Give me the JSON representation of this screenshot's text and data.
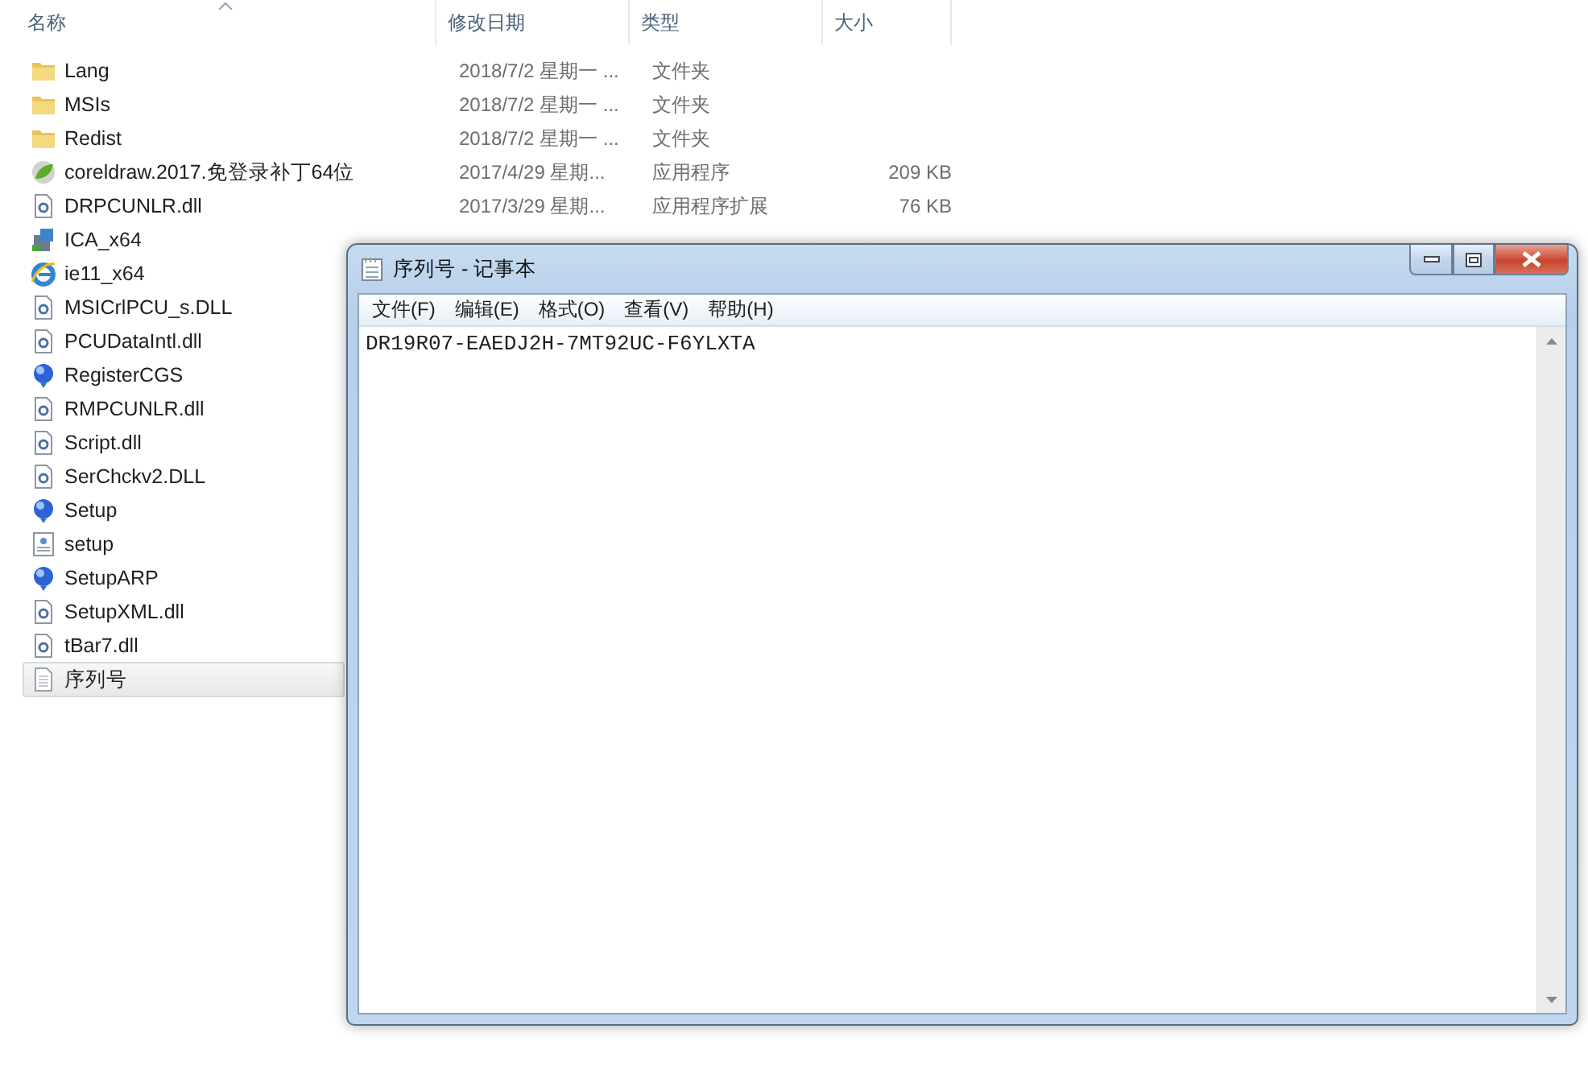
{
  "columns": [
    {
      "label": "名称",
      "sorted": true
    },
    {
      "label": "修改日期",
      "sorted": false
    },
    {
      "label": "类型",
      "sorted": false
    },
    {
      "label": "大小",
      "sorted": false
    }
  ],
  "files": [
    {
      "name": "Lang",
      "date": "2018/7/2 星期一 ...",
      "type": "文件夹",
      "kind": "folder",
      "selected": false
    },
    {
      "name": "MSIs",
      "date": "2018/7/2 星期一 ...",
      "type": "文件夹",
      "kind": "folder",
      "selected": false
    },
    {
      "name": "Redist",
      "date": "2018/7/2 星期一 ...",
      "type": "文件夹",
      "kind": "folder",
      "selected": false
    },
    {
      "name": "coreldraw.2017.免登录补丁64位",
      "date": "2017/4/29 星期...",
      "type": "应用程序",
      "size": "209 KB",
      "kind": "app",
      "selected": false
    },
    {
      "name": "DRPCUNLR.dll",
      "date": "2017/3/29 星期...",
      "type": "应用程序扩展",
      "size": "76 KB",
      "kind": "dll",
      "selected": false
    },
    {
      "name": "ICA_x64",
      "kind": "installer",
      "selected": false
    },
    {
      "name": "ie11_x64",
      "kind": "ie",
      "selected": false
    },
    {
      "name": "MSICrlPCU_s.DLL",
      "kind": "dll",
      "selected": false
    },
    {
      "name": "PCUDataIntl.dll",
      "kind": "dll",
      "selected": false
    },
    {
      "name": "RegisterCGS",
      "kind": "globe",
      "selected": false
    },
    {
      "name": "RMPCUNLR.dll",
      "kind": "dll",
      "selected": false
    },
    {
      "name": "Script.dll",
      "kind": "dll",
      "selected": false
    },
    {
      "name": "SerChckv2.DLL",
      "kind": "dll",
      "selected": false
    },
    {
      "name": "Setup",
      "kind": "globe",
      "selected": false
    },
    {
      "name": "setup",
      "kind": "config",
      "selected": false
    },
    {
      "name": "SetupARP",
      "kind": "globe",
      "selected": false
    },
    {
      "name": "SetupXML.dll",
      "kind": "dll",
      "selected": false
    },
    {
      "name": "tBar7.dll",
      "kind": "dll",
      "selected": false
    },
    {
      "name": "序列号",
      "kind": "text",
      "selected": true
    }
  ],
  "notepad": {
    "title": "序列号 - 记事本",
    "menu": [
      "文件(F)",
      "编辑(E)",
      "格式(O)",
      "查看(V)",
      "帮助(H)"
    ],
    "content": "DR19R07-EAEDJ2H-7MT92UC-F6YLXTA"
  }
}
